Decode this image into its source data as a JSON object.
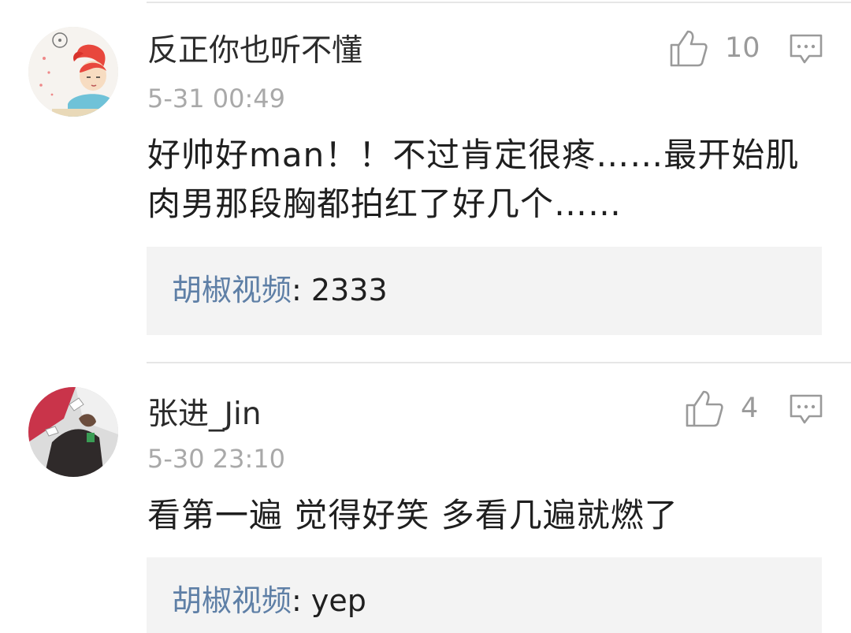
{
  "comments": [
    {
      "username": "反正你也听不懂",
      "time": "5-31 00:49",
      "text": "好帅好man！！不过肯定很疼……最开始肌肉男那段胸都拍红了好几个……",
      "likes": "10",
      "avatar_icon": "cartoon-girl-avatar",
      "reply": {
        "author": "胡椒视频",
        "separator": ":",
        "text": "2333"
      }
    },
    {
      "username": "张进_Jin",
      "time": "5-30 23:10",
      "text": "看第一遍 觉得好笑 多看几遍就燃了",
      "likes": "4",
      "avatar_icon": "photo-avatar",
      "reply": {
        "author": "胡椒视频",
        "separator": ":",
        "text": "yep"
      }
    }
  ],
  "icons": {
    "like": "thumbs-up-icon",
    "reply": "comment-bubble-icon"
  },
  "colors": {
    "reply_author": "#5e7fa6",
    "reply_background": "#f3f3f3",
    "muted": "#a9a9a9"
  }
}
